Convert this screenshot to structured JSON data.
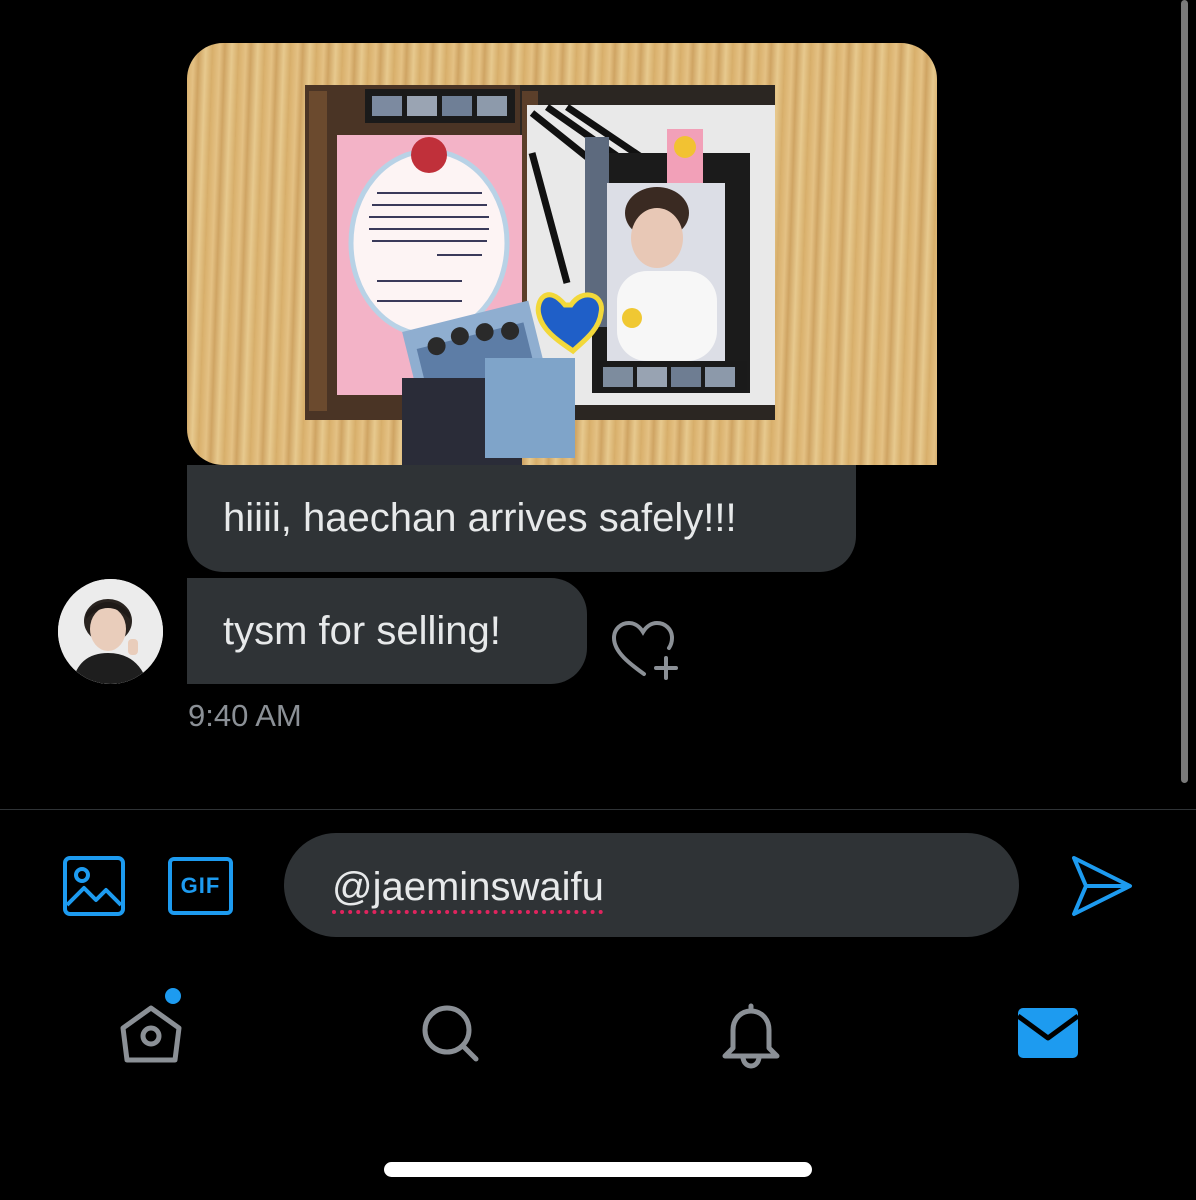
{
  "conversation": {
    "messages": [
      {
        "text": "hiiii, haechan arrives safely!!!"
      },
      {
        "text": "tysm for selling!"
      }
    ],
    "timestamp": "9:40 AM"
  },
  "composer": {
    "value": "@jaeminswaifu",
    "gif_label": "GIF"
  },
  "tabs": [
    {
      "name": "home",
      "icon": "home-icon",
      "has_notification_dot": true
    },
    {
      "name": "search",
      "icon": "search-icon"
    },
    {
      "name": "notifications",
      "icon": "bell-icon"
    },
    {
      "name": "messages",
      "icon": "mail-icon",
      "active": true
    }
  ],
  "colors": {
    "background": "#000000",
    "bubble": "#2f3336",
    "accent": "#1d9bf0",
    "timestamp": "#8b9096"
  }
}
